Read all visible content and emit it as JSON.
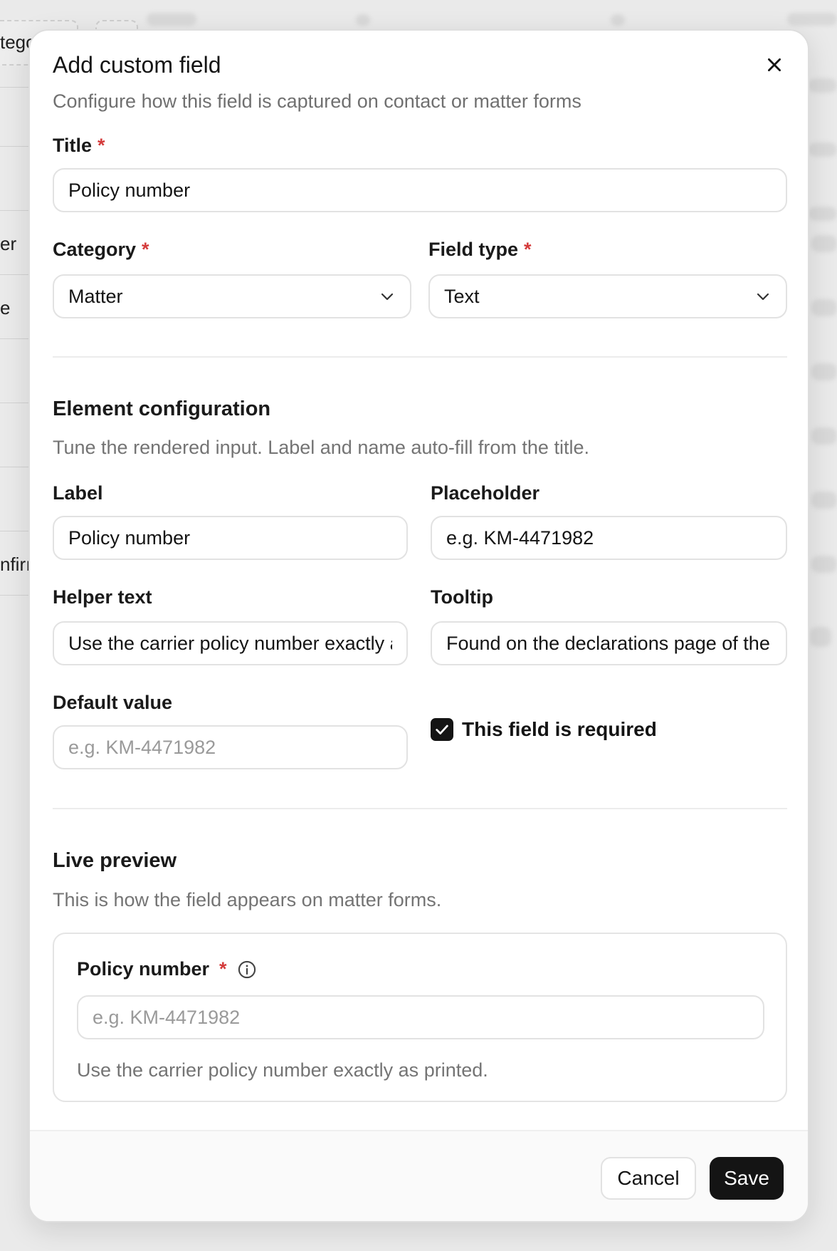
{
  "background": {
    "left_fragments": [
      "tego",
      "er",
      "e",
      "nfirı"
    ]
  },
  "modal": {
    "title": "Add custom field",
    "subtitle": "Configure how this field is captured on contact or matter forms",
    "required_marker": "*",
    "title_field": {
      "label": "Title",
      "value": "Policy number"
    },
    "category_field": {
      "label": "Category",
      "value": "Matter",
      "icon": "chevron-down-icon"
    },
    "field_type_field": {
      "label": "Field type",
      "value": "Text",
      "icon": "chevron-down-icon"
    },
    "element_config": {
      "title": "Element configuration",
      "description": "Tune the rendered input. Label and name auto-fill from the title.",
      "label_field": {
        "label": "Label",
        "value": "Policy number"
      },
      "placeholder_field": {
        "label": "Placeholder",
        "value": "e.g. KM-4471982"
      },
      "helper_field": {
        "label": "Helper text",
        "value": "Use the carrier policy number exactly as printed."
      },
      "tooltip_field": {
        "label": "Tooltip",
        "value": "Found on the declarations page of the policy."
      },
      "default_field": {
        "label": "Default value",
        "placeholder": "e.g. KM-4471982"
      },
      "required_checkbox": {
        "label": "This field is required",
        "checked": true
      }
    },
    "live_preview": {
      "title": "Live preview",
      "description": "This is how the field appears on matter forms.",
      "field_label": "Policy number",
      "field_placeholder": "e.g. KM-4471982",
      "helper_text": "Use the carrier policy number exactly as printed.",
      "info_icon": "info-icon"
    },
    "footer": {
      "cancel_label": "Cancel",
      "save_label": "Save"
    }
  },
  "colors": {
    "required": "#d43b3b",
    "primary_button": "#141414",
    "muted_text": "#747474"
  }
}
